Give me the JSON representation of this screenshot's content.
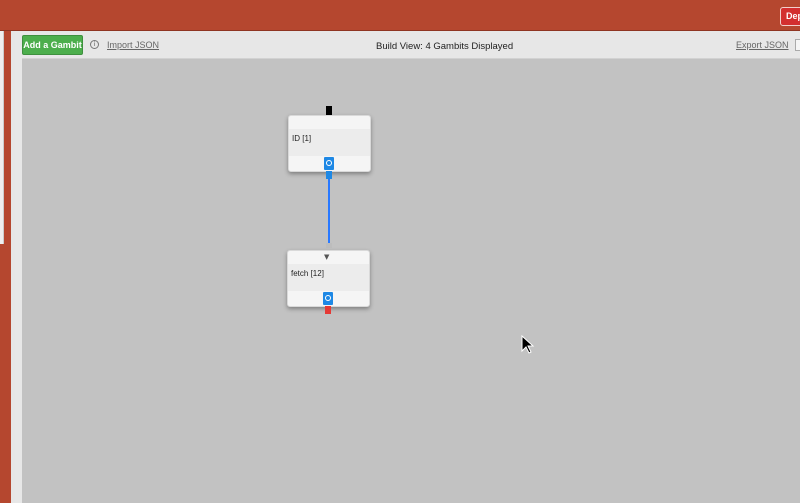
{
  "header": {
    "deploy_label": "Dep"
  },
  "toolbar": {
    "add_label": "Add a Gambit",
    "info_icon": "i",
    "import_label": "Import JSON",
    "title": "Build View: 4 Gambits Displayed",
    "export_label": "Export JSON"
  },
  "gambits": [
    {
      "label": "ID [1]"
    },
    {
      "label": "fetch [12]"
    }
  ],
  "icons": {
    "wifi": "▼"
  },
  "colors": {
    "topbar": "#b5472f",
    "add_button": "#4cae4c",
    "canvas": "#c2c2c2",
    "connector": "#2979ff",
    "error_port": "#e53935"
  }
}
